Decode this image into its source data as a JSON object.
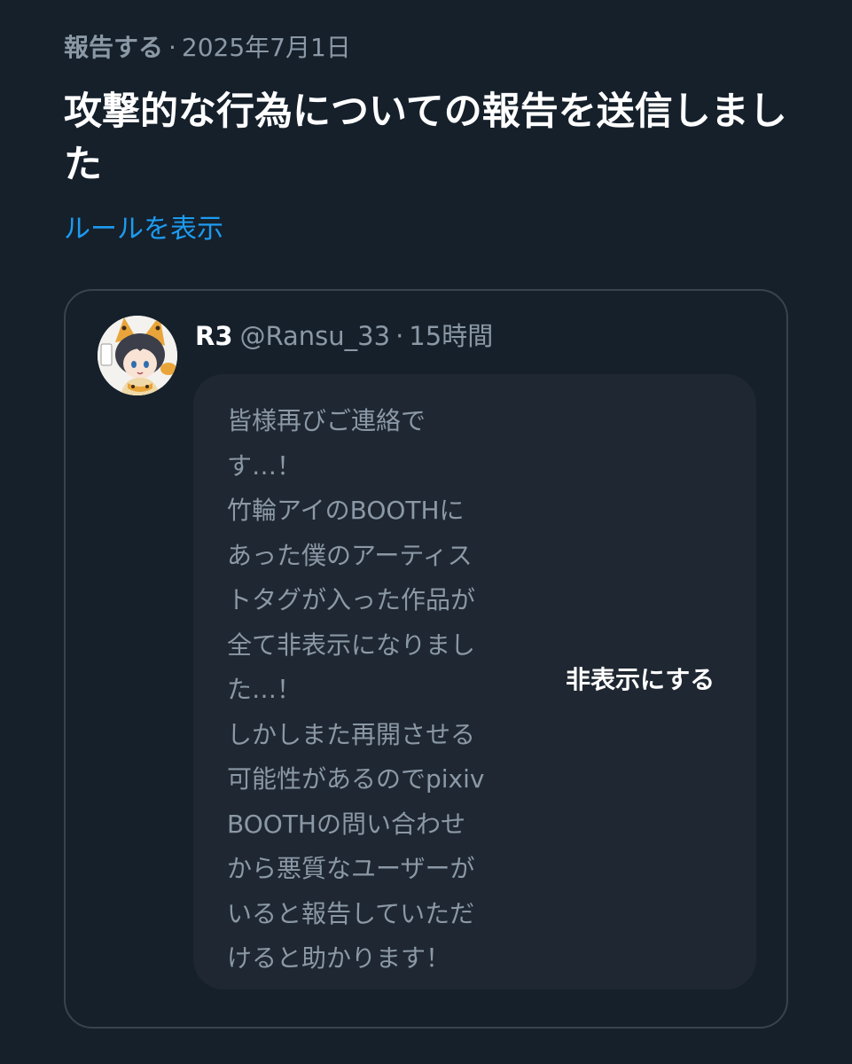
{
  "report": {
    "action_label": "報告する",
    "separator": "·",
    "date": "2025年7月1日",
    "title": "攻撃的な行為についての報告を送信しました",
    "rules_link": "ルールを表示"
  },
  "post": {
    "display_name": "R3",
    "handle": "@Ransu_33",
    "separator": "·",
    "time_ago": "15時間",
    "text": "皆様再びご連絡で\nす…！\n竹輪アイのBOOTHに\nあった僕のアーティス\nトタグが入った作品が\n全て非表示になりまし\nた…！\nしかしまた再開させる\n可能性があるのでpixiv\nBOOTHの問い合わせ\nから悪質なユーザーが\nいると報告していただ\nけると助かります！",
    "hide_button": "非表示にする"
  },
  "colors": {
    "background": "#15202b",
    "card_border": "#38444d",
    "hidden_box": "#1e2732",
    "muted_text": "#8b98a5",
    "link": "#1d9bf0",
    "primary_text": "#ffffff"
  },
  "icons": {
    "avatar": "user-avatar-illustration"
  }
}
